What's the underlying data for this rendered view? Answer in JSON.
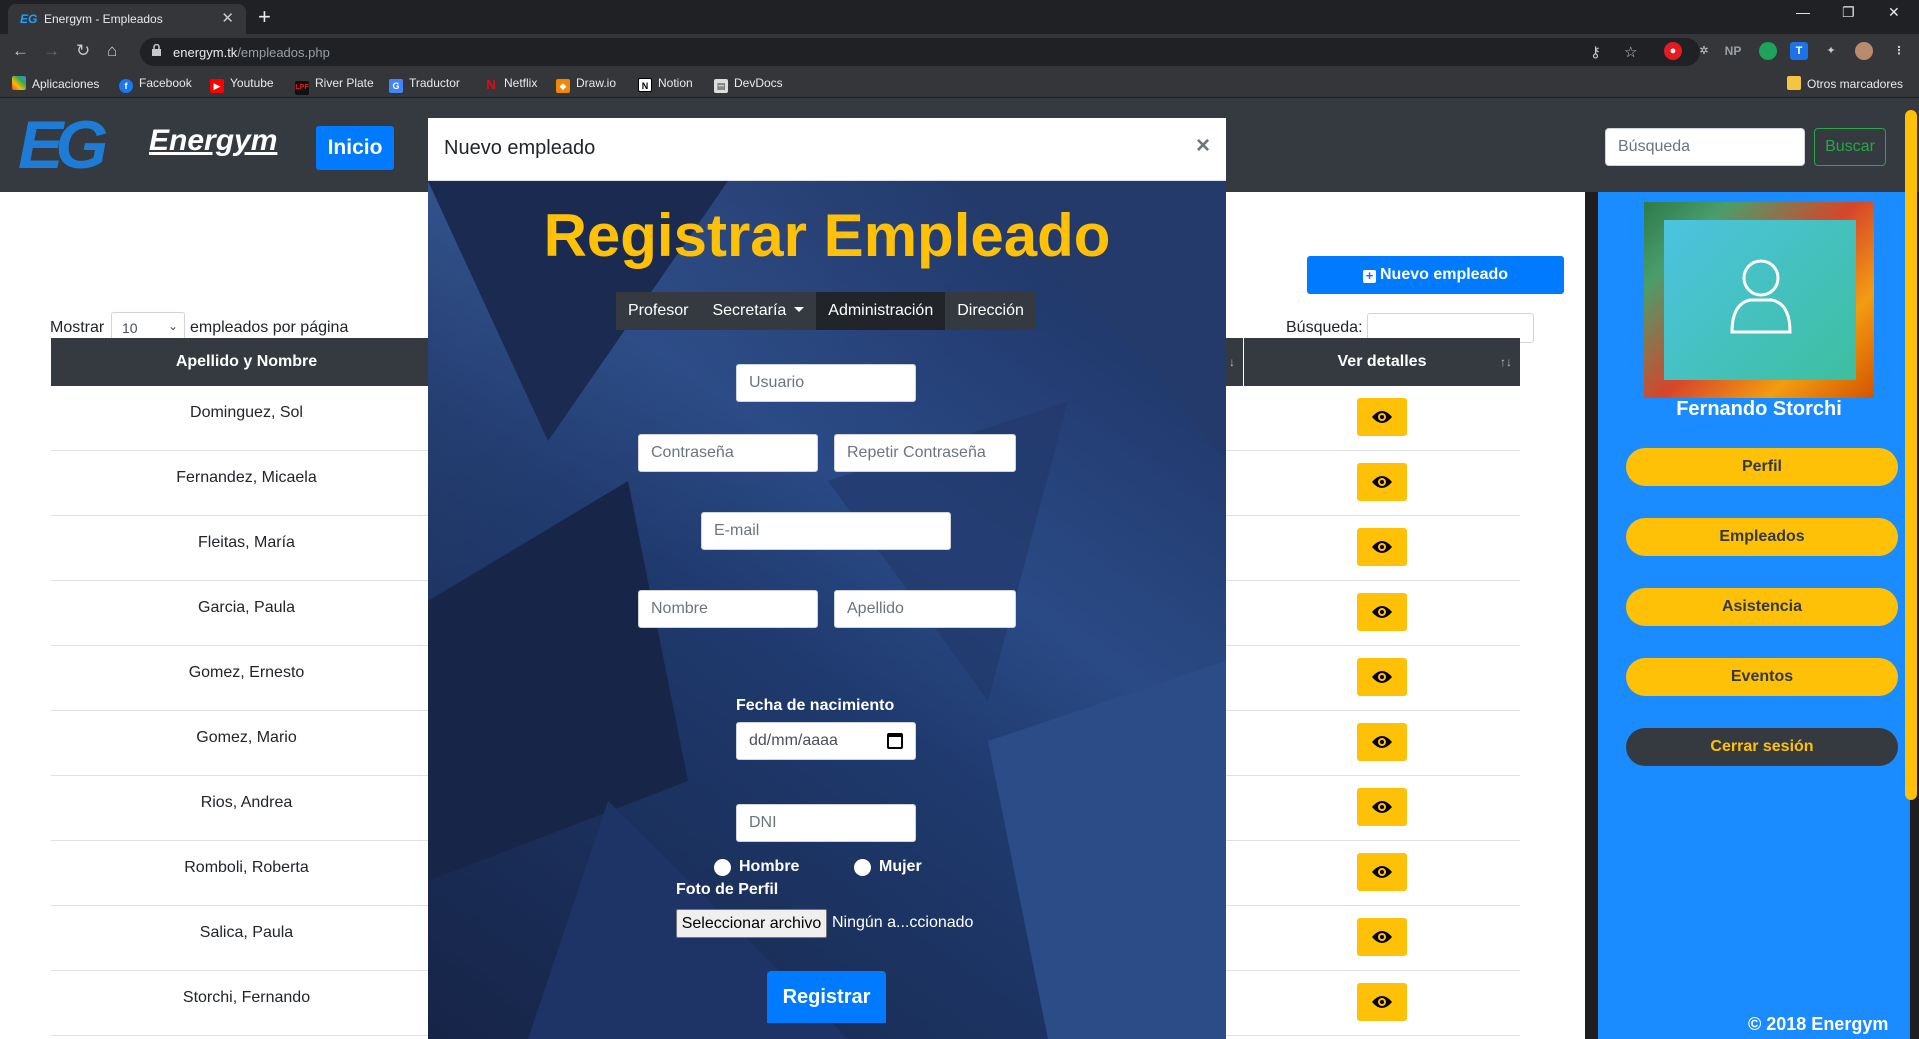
{
  "browser": {
    "tab_title": "Energym - Empleados",
    "url_host": "energym.tk",
    "url_path": "/empleados.php",
    "bookmarks": [
      "Aplicaciones",
      "Facebook",
      "Youtube",
      "River Plate",
      "Traductor",
      "Netflix",
      "Draw.io",
      "Notion",
      "DevDocs"
    ],
    "other_bookmarks": "Otros marcadores"
  },
  "navbar": {
    "logo_mark": "EG",
    "brand": "Energym",
    "home_button": "Inicio",
    "search_placeholder": "Búsqueda",
    "search_button": "Buscar"
  },
  "content": {
    "new_employee_button": "Nuevo empleado",
    "show_label": "Mostrar",
    "page_size": "10",
    "per_page_label": "empleados por página",
    "search_label": "Búsqueda:",
    "columns": [
      "Apellido y Nombre",
      "Ver detalles"
    ],
    "employees": [
      "Dominguez, Sol",
      "Fernandez, Micaela",
      "Fleitas, María",
      "Garcia, Paula",
      "Gomez, Ernesto",
      "Gomez, Mario",
      "Rios, Andrea",
      "Romboli, Roberta",
      "Salica, Paula",
      "Storchi, Fernando"
    ]
  },
  "sidebar": {
    "user_name": "Fernando Storchi",
    "menu": [
      "Perfil",
      "Empleados",
      "Asistencia",
      "Eventos"
    ],
    "logout": "Cerrar sesión",
    "copyright": "© 2018 Energym"
  },
  "modal": {
    "title": "Nuevo empleado",
    "close": "×",
    "heading": "Registrar Empleado",
    "role_tabs": [
      "Profesor",
      "Secretaría",
      "Administración",
      "Dirección"
    ],
    "active_tab": "Administración",
    "fields": {
      "usuario": "Usuario",
      "password": "Contraseña",
      "password_repeat": "Repetir Contraseña",
      "email": "E-mail",
      "nombre": "Nombre",
      "apellido": "Apellido",
      "birth_label": "Fecha de nacimiento",
      "birth_placeholder": "dd/mm/aaaa",
      "dni": "DNI"
    },
    "gender": [
      "Hombre",
      "Mujer"
    ],
    "photo_label": "Foto de Perfil",
    "file_button": "Seleccionar archivo",
    "file_status": "Ningún a...ccionado",
    "submit": "Registrar"
  }
}
